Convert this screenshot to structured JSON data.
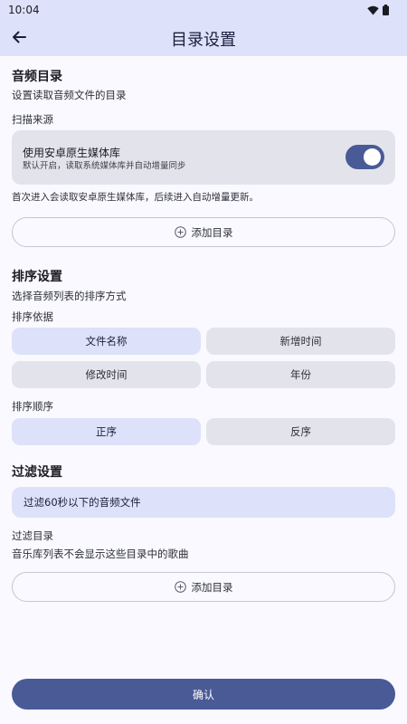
{
  "status_bar": {
    "time": "10:04",
    "icons": [
      "wifi-icon",
      "battery-icon"
    ]
  },
  "app_bar": {
    "back_icon": "arrow-left-icon",
    "title": "目录设置"
  },
  "audio_dir": {
    "title": "音频目录",
    "description": "设置读取音频文件的目录",
    "scan_source_label": "扫描来源",
    "media_card": {
      "title": "使用安卓原生媒体库",
      "subtitle": "默认开启，读取系统媒体库并自动增量同步",
      "toggle_on": true
    },
    "note": "首次进入会读取安卓原生媒体库，后续进入自动增量更新。",
    "add_button_label": "添加目录",
    "add_icon": "plus-circle-icon"
  },
  "sort": {
    "title": "排序设置",
    "description": "选择音频列表的排序方式",
    "basis_label": "排序依据",
    "basis_options": [
      {
        "label": "文件名称",
        "selected": true
      },
      {
        "label": "新增时间",
        "selected": false
      },
      {
        "label": "修改时间",
        "selected": false
      },
      {
        "label": "年份",
        "selected": false
      }
    ],
    "order_label": "排序顺序",
    "order_options": [
      {
        "label": "正序",
        "selected": true
      },
      {
        "label": "反序",
        "selected": false
      }
    ]
  },
  "filter": {
    "title": "过滤设置",
    "duration_filter": "过滤60秒以下的音频文件",
    "dir_label": "过滤目录",
    "dir_description": "音乐库列表不会显示这些目录中的歌曲",
    "add_button_label": "添加目录"
  },
  "confirm_label": "确认",
  "colors": {
    "app_bar_bg": "#dde2fa",
    "primary": "#4a5a96",
    "card_bg": "#e3e3eb",
    "selected_chip_bg": "#dde2fa"
  }
}
